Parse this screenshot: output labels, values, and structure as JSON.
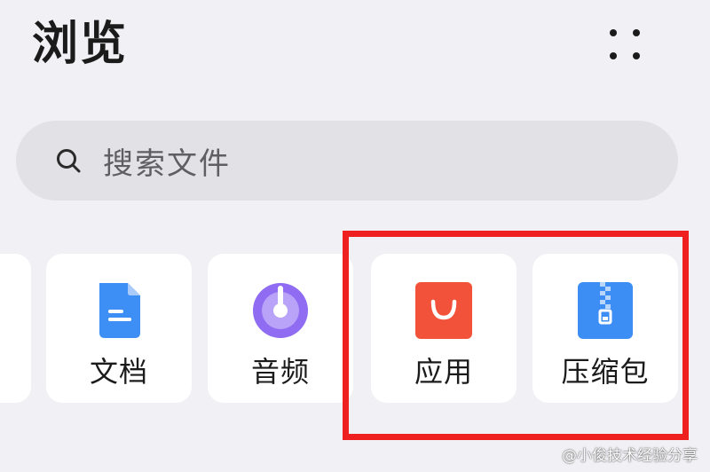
{
  "header": {
    "title": "浏览",
    "more_icon": "more-dots-icon"
  },
  "search": {
    "placeholder": "搜索文件",
    "icon": "search-icon"
  },
  "categories": [
    {
      "label": "文档",
      "icon": "document-icon",
      "color": "#3d8ff6"
    },
    {
      "label": "音频",
      "icon": "audio-disc-icon",
      "color": "#8f6cf2"
    },
    {
      "label": "应用",
      "icon": "shopping-bag-icon",
      "color": "#f2523a"
    },
    {
      "label": "压缩包",
      "icon": "zip-archive-icon",
      "color": "#3c8ef4"
    }
  ],
  "highlight": {
    "color": "#ef2020"
  },
  "watermark": {
    "text": "@小俊技术经验分享"
  }
}
